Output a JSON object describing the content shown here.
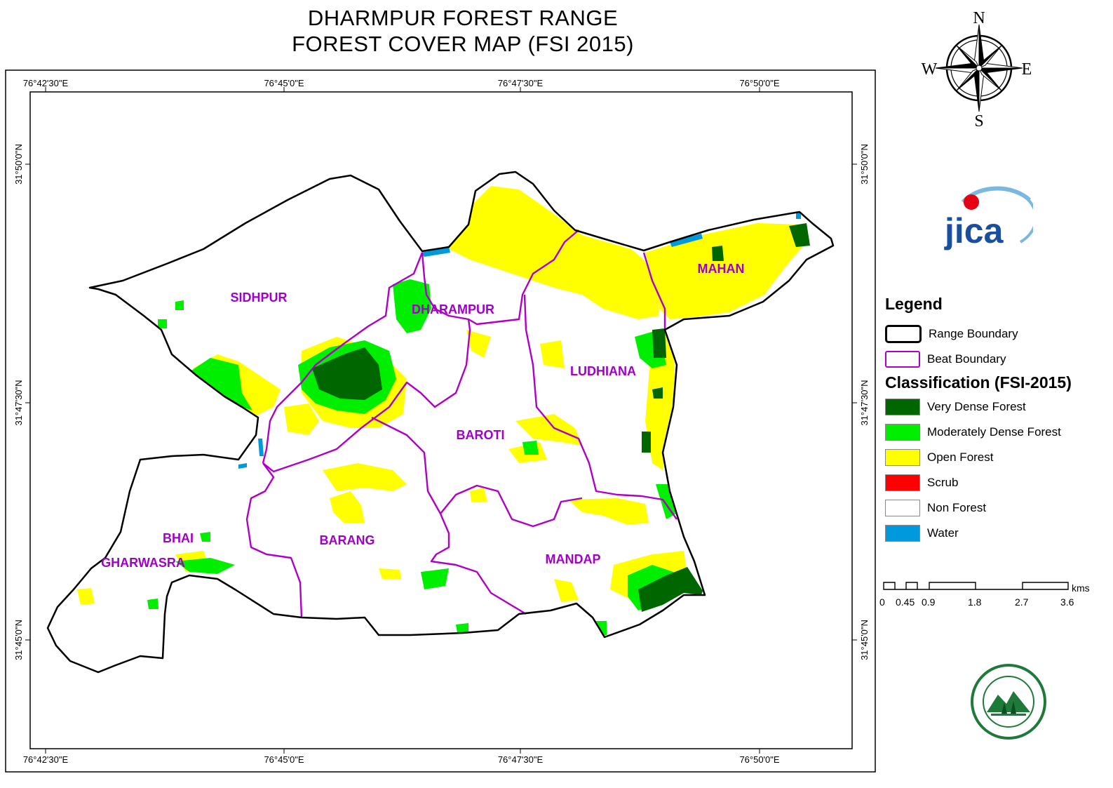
{
  "title": {
    "line1": "DHARMPUR FOREST RANGE",
    "line2": "FOREST COVER MAP (FSI 2015)"
  },
  "compass": {
    "n": "N",
    "s": "S",
    "e": "E",
    "w": "W"
  },
  "graticule": {
    "longitudes": [
      "76°42'30\"E",
      "76°45'0\"E",
      "76°47'30\"E",
      "76°50'0\"E"
    ],
    "latitudes": [
      "31°50'0\"N",
      "31°47'30\"N",
      "31°45'0\"N"
    ]
  },
  "beats": {
    "sidhpur": "SIDHPUR",
    "dharampur": "DHARAMPUR",
    "mahan": "MAHAN",
    "ludhiana": "LUDHIANA",
    "baroti": "BAROTI",
    "barang": "BARANG",
    "mandap": "MANDAP",
    "bhai": "BHAI",
    "gharwasra": "GHARWASRA"
  },
  "logo": {
    "jica": "JICA"
  },
  "legend": {
    "heading": "Legend",
    "range_boundary": "Range Boundary",
    "beat_boundary": "Beat Boundary",
    "classification_heading": "Classification (FSI-2015)",
    "classes": [
      {
        "label": "Very Dense Forest",
        "color": "#006600"
      },
      {
        "label": "Moderately Dense Forest",
        "color": "#00ee00"
      },
      {
        "label": "Open Forest",
        "color": "#ffff00"
      },
      {
        "label": "Scrub",
        "color": "#ff0000"
      },
      {
        "label": "Non Forest",
        "color": "#ffffff"
      },
      {
        "label": "Water",
        "color": "#0099dd"
      }
    ]
  },
  "scale_bar": {
    "unit": "kms",
    "ticks": [
      "0",
      "0.45",
      "0.9",
      "1.8",
      "2.7",
      "3.6"
    ]
  },
  "colors": {
    "range_boundary": "#000000",
    "beat_boundary": "#b000c8",
    "beat_label": "#a000c8"
  }
}
